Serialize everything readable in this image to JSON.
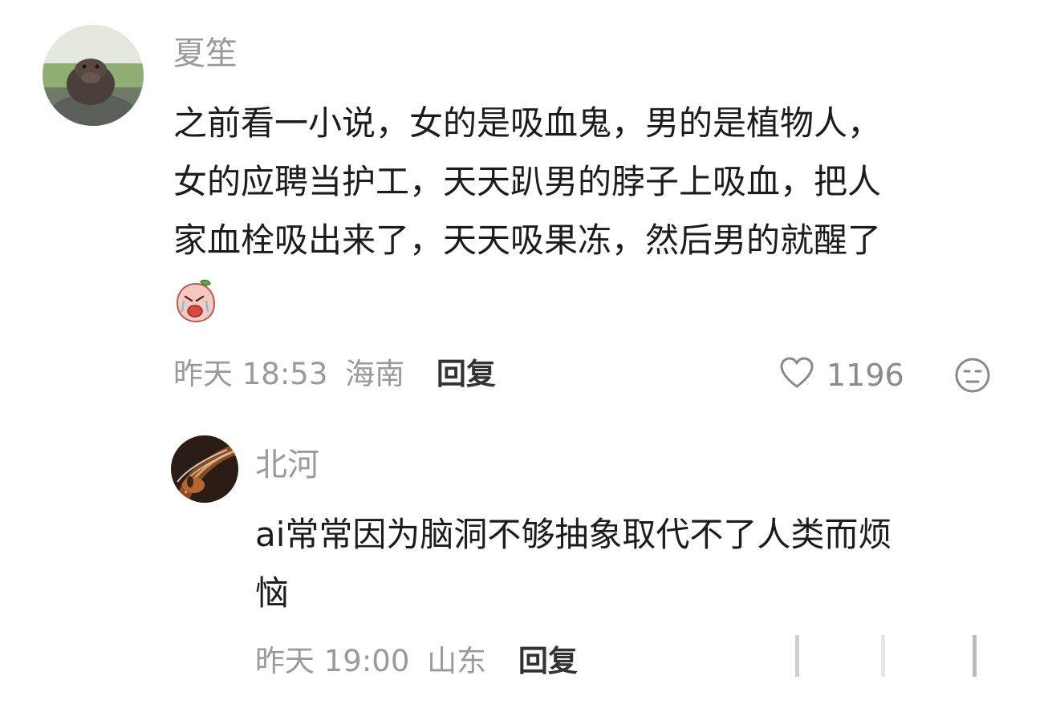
{
  "comment": {
    "username": "夏笙",
    "text_lines": [
      "之前看一小说，女的是吸血鬼，男的是植物人，",
      "女的应聘当护工，天天趴男的脖子上吸血，把人",
      "家血栓吸出来了，天天吸果冻，然后男的就醒了"
    ],
    "time": "昨天 18:53",
    "location": "海南",
    "reply_label": "回复",
    "like_count": "1196"
  },
  "reply": {
    "username": "北河",
    "text_lines": [
      "ai常常因为脑洞不够抽象取代不了人类而烦",
      "恼"
    ],
    "time": "昨天 19:00",
    "location": "山东",
    "reply_label": "回复"
  },
  "icons": {
    "like": "heart-outline-icon",
    "dislike": "meh-face-icon",
    "sticker": "crying-peach-sticker"
  },
  "colors": {
    "name": "#9a9a9a",
    "text": "#1c1c1c",
    "meta": "#9a9a9a",
    "reply": "#333333"
  }
}
